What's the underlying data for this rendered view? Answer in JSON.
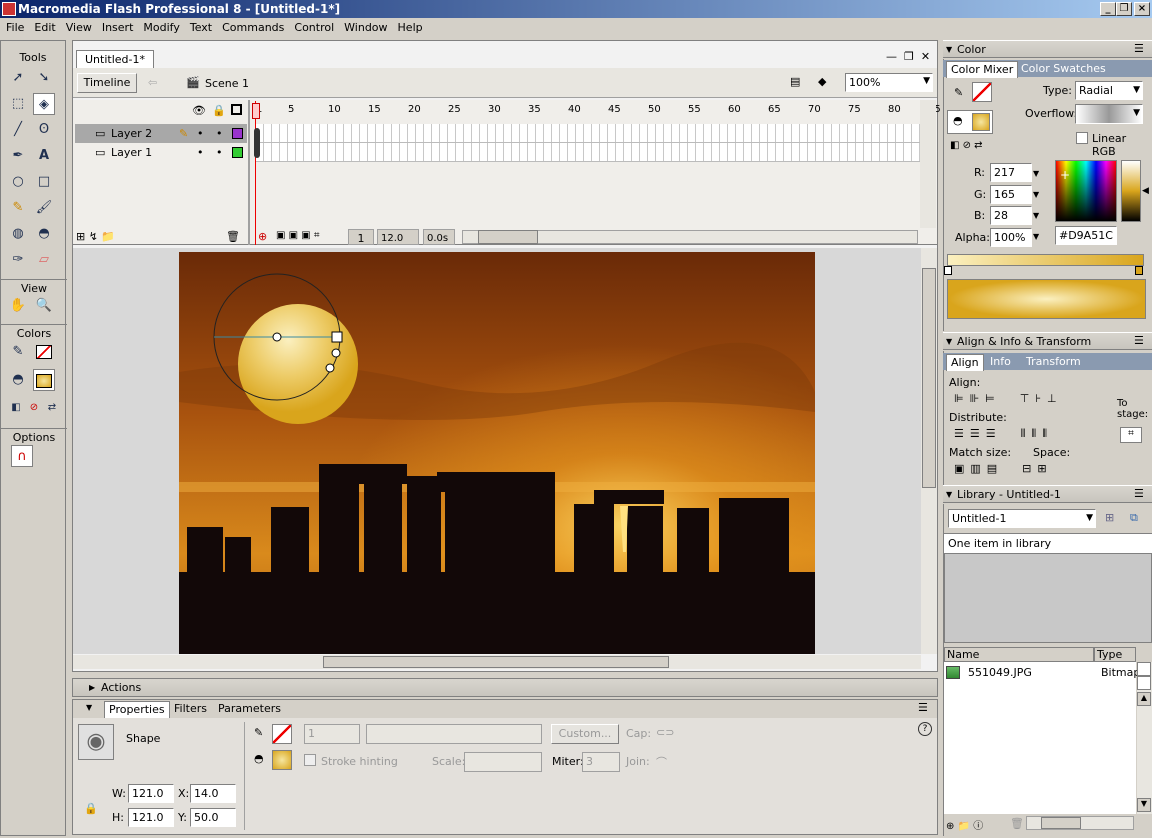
{
  "window": {
    "title": "Macromedia Flash Professional 8 - [Untitled-1*]"
  },
  "menu": [
    "File",
    "Edit",
    "View",
    "Insert",
    "Modify",
    "Text",
    "Commands",
    "Control",
    "Window",
    "Help"
  ],
  "tools": {
    "title": "Tools",
    "view_label": "View",
    "colors_label": "Colors",
    "options_label": "Options"
  },
  "document": {
    "tab": "Untitled-1*",
    "timeline_btn": "Timeline",
    "scene": "Scene 1",
    "zoom": "100%"
  },
  "timeline": {
    "ruler": [
      "1",
      "5",
      "10",
      "15",
      "20",
      "25",
      "30",
      "35",
      "40",
      "45",
      "50",
      "55",
      "60",
      "65",
      "70",
      "75",
      "80",
      "85"
    ],
    "layers": [
      {
        "name": "Layer 2",
        "color": "#9933cc"
      },
      {
        "name": "Layer 1",
        "color": "#33cc33"
      }
    ],
    "frame": "1",
    "fps": "12.0 fps",
    "time": "0.0s"
  },
  "stage": {
    "gradient_center": "#e9c150",
    "gradient_edge": "#d9a51c"
  },
  "actions": {
    "label": "Actions"
  },
  "properties": {
    "tabs": [
      "Properties",
      "Filters",
      "Parameters"
    ],
    "shape_label": "Shape",
    "stroke_width": "1",
    "custom_btn": "Custom...",
    "cap_label": "Cap:",
    "stroke_hinting": "Stroke hinting",
    "scale_label": "Scale:",
    "miter_label": "Miter:",
    "miter_value": "3",
    "join_label": "Join:",
    "w_label": "W:",
    "w": "121.0",
    "h_label": "H:",
    "h": "121.0",
    "x_label": "X:",
    "x": "14.0",
    "y_label": "Y:",
    "y": "50.0"
  },
  "color": {
    "title": "Color",
    "tabs": [
      "Color Mixer",
      "Color Swatches"
    ],
    "type_label": "Type:",
    "type": "Radial",
    "overflow_label": "Overflow:",
    "linear_rgb": "Linear RGB",
    "r_label": "R:",
    "r": "217",
    "g_label": "G:",
    "g": "165",
    "b_label": "B:",
    "b": "28",
    "alpha_label": "Alpha:",
    "alpha": "100%",
    "hex": "#D9A51C"
  },
  "align": {
    "title": "Align & Info & Transform",
    "tabs": [
      "Align",
      "Info",
      "Transform"
    ],
    "align_label": "Align:",
    "distribute_label": "Distribute:",
    "match_label": "Match size:",
    "space_label": "Space:",
    "to_stage": "To stage:"
  },
  "library": {
    "title": "Library - Untitled-1",
    "selector": "Untitled-1",
    "count": "One item in library",
    "col_name": "Name",
    "col_type": "Type",
    "items": [
      {
        "name": "551049.JPG",
        "type": "Bitmap"
      }
    ]
  }
}
